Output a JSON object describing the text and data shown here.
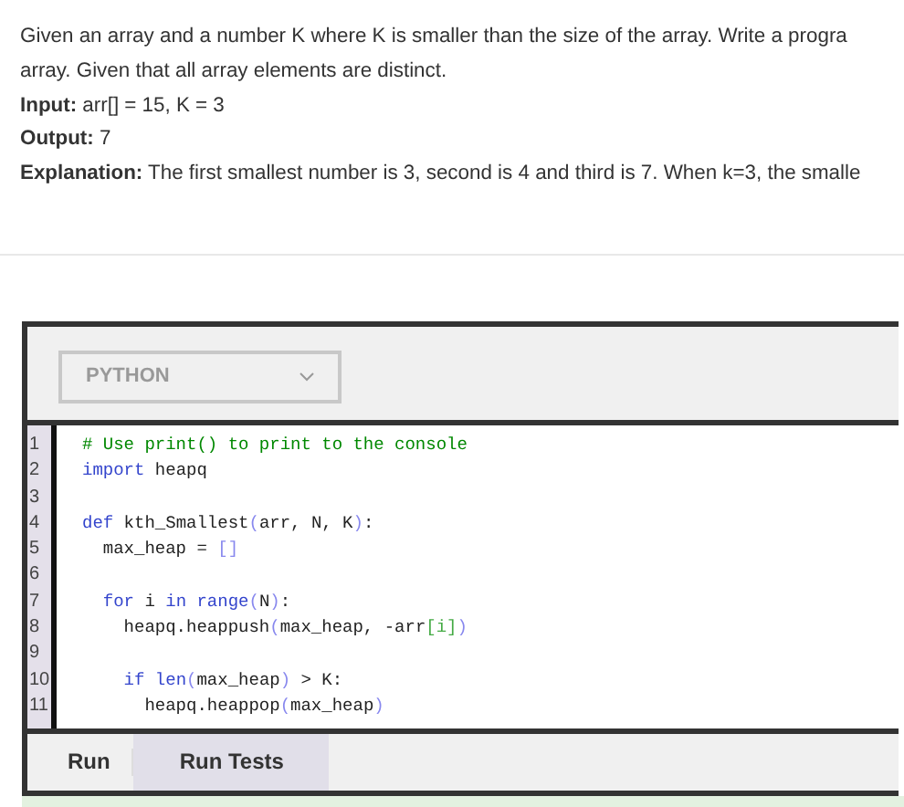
{
  "problem": [
    {
      "text": "Given an array and a number K where K is smaller than the size of the array. Write a progra"
    },
    {
      "text": "array. Given that all array elements are distinct."
    },
    {
      "label": "Input:",
      "text": "arr[] = 15, K = 3"
    },
    {
      "label": "Output:",
      "text": "7"
    },
    {
      "label": "Explanation:",
      "text": "The first smallest number is 3, second is 4 and third is 7. When k=3, the smalle"
    }
  ],
  "editor": {
    "language": "PYTHON",
    "lines": [
      {
        "number": "1",
        "tokens": [
          {
            "kind": "comment",
            "text": "# Use print() to print to the console"
          }
        ]
      },
      {
        "number": "2",
        "tokens": [
          {
            "kind": "keyword",
            "text": "import"
          },
          {
            "kind": "plain",
            "text": " heapq"
          }
        ]
      },
      {
        "number": "3"
      },
      {
        "number": "4",
        "tokens": [
          {
            "kind": "keyword",
            "text": "def"
          },
          {
            "kind": "plain",
            "text": " kth_Smallest"
          },
          {
            "kind": "bracket",
            "text": "("
          },
          {
            "kind": "plain",
            "text": "arr, N, K"
          },
          {
            "kind": "bracket",
            "text": ")"
          },
          {
            "kind": "plain",
            "text": ":"
          }
        ]
      },
      {
        "number": "5",
        "tokens": [
          {
            "kind": "plain",
            "text": "  max_heap = "
          },
          {
            "kind": "bracket",
            "text": "[]"
          }
        ]
      },
      {
        "number": "6"
      },
      {
        "number": "7",
        "tokens": [
          {
            "kind": "keyword",
            "text": "  for"
          },
          {
            "kind": "plain",
            "text": " i "
          },
          {
            "kind": "keyword",
            "text": "in"
          },
          {
            "kind": "keyword",
            "text": " range"
          },
          {
            "kind": "bracket",
            "text": "("
          },
          {
            "kind": "plain",
            "text": "N"
          },
          {
            "kind": "bracket",
            "text": ")"
          },
          {
            "kind": "plain",
            "text": ":"
          }
        ]
      },
      {
        "number": "8",
        "tokens": [
          {
            "kind": "plain",
            "text": "    heapq.heappush"
          },
          {
            "kind": "bracket",
            "text": "("
          },
          {
            "kind": "plain",
            "text": "max_heap, -arr"
          },
          {
            "kind": "inner",
            "text": "[i]"
          },
          {
            "kind": "bracket",
            "text": ")"
          }
        ]
      },
      {
        "number": "9"
      },
      {
        "number": "10",
        "tokens": [
          {
            "kind": "keyword",
            "text": "    if"
          },
          {
            "kind": "keyword",
            "text": " len"
          },
          {
            "kind": "bracket",
            "text": "("
          },
          {
            "kind": "plain",
            "text": "max_heap"
          },
          {
            "kind": "bracket",
            "text": ")"
          },
          {
            "kind": "plain",
            "text": " > K:"
          }
        ]
      },
      {
        "number": "11",
        "tokens": [
          {
            "kind": "plain",
            "text": "      heapq.heappop"
          },
          {
            "kind": "bracket",
            "text": "("
          },
          {
            "kind": "plain",
            "text": "max_heap"
          },
          {
            "kind": "bracket",
            "text": ")"
          }
        ]
      }
    ]
  },
  "buttons": [
    {
      "label": "Run",
      "selected": false
    },
    {
      "label": "Run Tests",
      "selected": true
    }
  ]
}
